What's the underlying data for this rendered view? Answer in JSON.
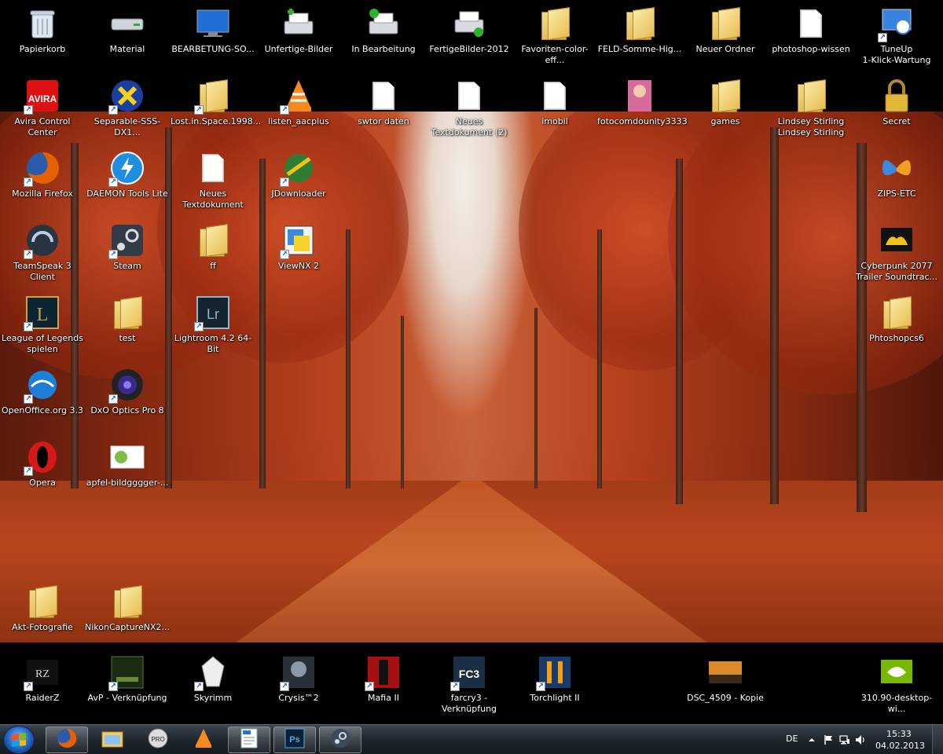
{
  "desktop": {
    "top_row_1": [
      {
        "label": "Papierkorb",
        "icon": "recycle-bin-icon",
        "shortcut": false
      },
      {
        "label": "Material",
        "icon": "drive-icon",
        "shortcut": false
      },
      {
        "label": "BEARBETUNG-SO...",
        "icon": "monitor-icon",
        "shortcut": false
      },
      {
        "label": "Unfertige-Bilder",
        "icon": "printer-add-icon",
        "shortcut": false
      },
      {
        "label": "In Bearbeitung",
        "icon": "printer-check-icon",
        "shortcut": false
      },
      {
        "label": "FertigeBilder-2012",
        "icon": "printer-done-icon",
        "shortcut": false
      },
      {
        "label": "Favoriten-color-eff...",
        "icon": "folder-icon",
        "shortcut": false
      },
      {
        "label": "FELD-Somme-Hig...",
        "icon": "folder-icon",
        "shortcut": false
      },
      {
        "label": "Neuer Ordner",
        "icon": "folder-photo-icon",
        "shortcut": false
      },
      {
        "label": "photoshop-wissen",
        "icon": "document-icon",
        "shortcut": false
      },
      {
        "label": "TuneUp\n1-Klick-Wartung",
        "icon": "tuneup-icon",
        "shortcut": true
      }
    ],
    "top_row_2": [
      {
        "label": "Avira Control Center",
        "icon": "avira-icon",
        "shortcut": true
      },
      {
        "label": "Separable-SSS-DX1...",
        "icon": "x-app-icon",
        "shortcut": true
      },
      {
        "label": "Lost.in.Space.1998...",
        "icon": "folder-movie-icon",
        "shortcut": true
      },
      {
        "label": "listen_aacplus",
        "icon": "vlc-icon",
        "shortcut": true
      },
      {
        "label": "swtor daten",
        "icon": "document-icon",
        "shortcut": false
      },
      {
        "label": "Neues\nTextdokument (2)",
        "icon": "document-icon",
        "shortcut": false
      },
      {
        "label": "imobil",
        "icon": "document-icon",
        "shortcut": false
      },
      {
        "label": "fotocomdounity3333",
        "icon": "portrait-image-icon",
        "shortcut": false
      },
      {
        "label": "games",
        "icon": "folder-icon",
        "shortcut": false
      },
      {
        "label": "Lindsey Stirling\nLindsey Stirling",
        "icon": "folder-portrait-icon",
        "shortcut": false
      },
      {
        "label": "Secret",
        "icon": "padlock-icon",
        "shortcut": false
      }
    ],
    "left_grid": [
      {
        "label": "Mozilla Firefox",
        "icon": "firefox-icon",
        "shortcut": true
      },
      {
        "label": "DAEMON Tools Lite",
        "icon": "daemon-tools-icon",
        "shortcut": true
      },
      {
        "label": "Neues\nTextdokument",
        "icon": "document-icon",
        "shortcut": false
      },
      {
        "label": "JDownloader",
        "icon": "jdownloader-icon",
        "shortcut": true
      },
      {
        "label": "TeamSpeak 3 Client",
        "icon": "teamspeak-icon",
        "shortcut": true
      },
      {
        "label": "Steam",
        "icon": "steam-icon",
        "shortcut": true
      },
      {
        "label": "ff",
        "icon": "folder-photo-icon",
        "shortcut": false
      },
      {
        "label": "ViewNX 2",
        "icon": "viewnx-icon",
        "shortcut": true
      },
      {
        "label": "League of Legends\nspielen",
        "icon": "lol-icon",
        "shortcut": true
      },
      {
        "label": "test",
        "icon": "folder-icon",
        "shortcut": false
      },
      {
        "label": "Lightroom 4.2 64-Bit",
        "icon": "lightroom-icon",
        "shortcut": true
      },
      {
        "label": "OpenOffice.org 3.3",
        "icon": "openoffice-icon",
        "shortcut": true
      },
      {
        "label": "DxO Optics Pro 8",
        "icon": "dxo-icon",
        "shortcut": true
      },
      {
        "label": "Opera",
        "icon": "opera-icon",
        "shortcut": true
      },
      {
        "label": "apfel-bildgggger-...",
        "icon": "image-thumbnail-icon",
        "shortcut": false
      },
      {
        "label": "Akt-Fotografie",
        "icon": "folder-photo-icon",
        "shortcut": false
      },
      {
        "label": "NikonCaptureNX2...",
        "icon": "folder-icon",
        "shortcut": false
      }
    ],
    "right_column": [
      {
        "label": "ZIPS-ETC",
        "icon": "butterfly-icon",
        "shortcut": false
      },
      {
        "label": "Cyberpunk 2077\nTrailer Soundtrac...",
        "icon": "soundcloud-icon",
        "shortcut": false
      },
      {
        "label": "Phtoshopcs6",
        "icon": "folder-blue-icon",
        "shortcut": false
      }
    ],
    "bottom_row": [
      {
        "label": "RaiderZ",
        "icon": "raiderz-icon",
        "shortcut": true
      },
      {
        "label": "AvP - Verknüpfung",
        "icon": "avp-icon",
        "shortcut": true
      },
      {
        "label": "Skyrimm",
        "icon": "skyrim-icon",
        "shortcut": true
      },
      {
        "label": "Crysis™2",
        "icon": "crysis-icon",
        "shortcut": true
      },
      {
        "label": "Mafia II",
        "icon": "mafia-icon",
        "shortcut": true
      },
      {
        "label": "farcry3 -\nVerknüpfung",
        "icon": "farcry3-icon",
        "shortcut": true
      },
      {
        "label": "Torchlight II",
        "icon": "torchlight-icon",
        "shortcut": true
      },
      {
        "label": "DSC_4509 - Kopie",
        "icon": "photo-thumbnail-icon",
        "shortcut": false
      },
      {
        "label": "310.90-desktop-wi...",
        "icon": "nvidia-icon",
        "shortcut": false
      }
    ]
  },
  "taskbar": {
    "pinned": [
      {
        "name": "firefox-taskbar-icon",
        "active": true
      },
      {
        "name": "explorer-taskbar-icon",
        "active": false
      },
      {
        "name": "daemon-pro-taskbar-icon",
        "active": false
      },
      {
        "name": "vlc-taskbar-icon",
        "active": false
      },
      {
        "name": "odf-document-taskbar-icon",
        "active": true
      },
      {
        "name": "photoshop-taskbar-icon",
        "active": true
      },
      {
        "name": "steam-taskbar-icon",
        "active": true
      }
    ],
    "tray": {
      "language": "DE",
      "time": "15:33",
      "date": "04.02.2013"
    }
  },
  "colors": {
    "taskbar": "#1f262e",
    "wallpaper_primary": "#b8431e",
    "accent_blue": "#2a6fd0"
  }
}
